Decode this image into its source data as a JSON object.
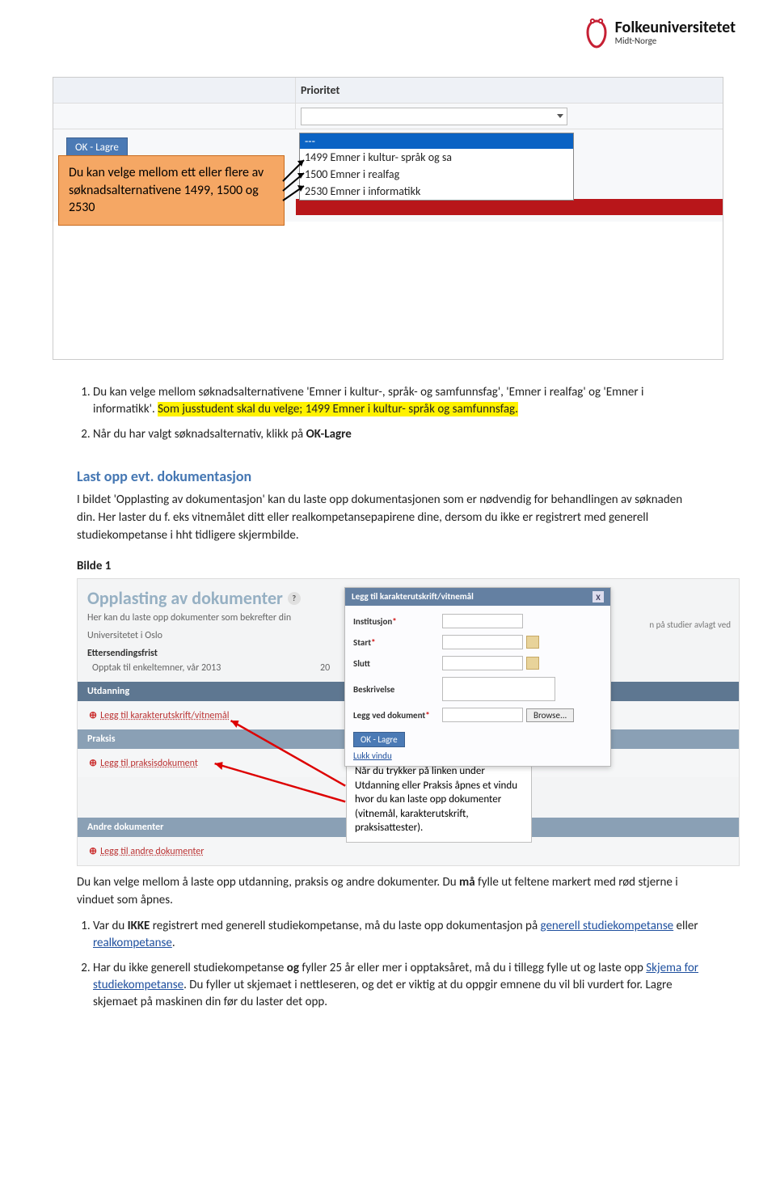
{
  "logo": {
    "name": "Folkeuniversitetet",
    "sub": "Midt-Norge"
  },
  "screenshot1": {
    "table_header": "Prioritet",
    "dropdown_placeholder": "---",
    "options": [
      "1499 Emner i kultur- språk og sa",
      "1500 Emner i realfag",
      "2530 Emner i informatikk"
    ],
    "ok_button": "OK - Lagre",
    "callout": "Du kan velge mellom ett eller flere av søknadsalternativene 1499, 1500 og 2530"
  },
  "list1": {
    "item1_pre": "Du kan velge mellom søknadsalternativene 'Emner i kultur-, språk- og samfunnsfag', 'Emner i realfag' og 'Emner i informatikk'. ",
    "item1_hl": "Som jusstudent skal du velge; 1499 Emner i kultur- språk og samfunnsfag.",
    "item2_pre": "Når du har valgt søknadsalternativ, klikk på ",
    "item2_bold": "OK-Lagre"
  },
  "section_heading": "Last opp evt. dokumentasjon",
  "para1": "I bildet 'Opplasting av dokumentasjon' kan du laste opp dokumentasjonen som er nødvendig for behandlingen av søknaden din. Her laster du f. eks vitnemålet ditt eller realkompetansepapirene dine, dersom du ikke er registrert med generell studiekompetanse i hht tidligere skjermbilde.",
  "bilde1_label": "Bilde 1",
  "screenshot2": {
    "title": "Opplasting av dokumenter",
    "help_icon": "?",
    "subtitle": "Her kan du laste opp dokumenter som bekrefter din ",
    "right_note": "n på studier avlagt ved",
    "right_note2": "Universitetet i Oslo",
    "etfrist": "Ettersendingsfrist",
    "etsub": "Opptak til enkeltemner, vår 2013",
    "etsub_date": "20",
    "sec_utdanning": "Utdanning",
    "link_utd": "Legg til karakterutskrift/vitnemål",
    "sec_praksis": "Praksis",
    "link_prk": "Legg til praksisdokument",
    "sec_andre": "Andre dokumenter",
    "link_andre": "Legg til andre dokumenter",
    "modal": {
      "title": "Legg til karakterutskrift/vitnemål",
      "close": "X",
      "institusjon": "Institusjon",
      "start": "Start",
      "slutt": "Slutt",
      "beskrivelse": "Beskrivelse",
      "legg_ved": "Legg ved dokument",
      "browse": "Browse...",
      "ok": "OK - Lagre",
      "lukk": "Lukk vindu"
    },
    "callout": "Når du trykker på linken under Utdanning eller Praksis åpnes et vindu hvor du kan laste opp dokumenter (vitnemål, karakterutskrift, praksisattester)."
  },
  "para2_a": "Du kan velge mellom å laste opp utdanning, praksis og andre dokumenter. Du ",
  "para2_b": "må",
  "para2_c": " fylle ut feltene markert med rød stjerne i vinduet som åpnes.",
  "list2": {
    "item1_a": "Var du ",
    "item1_b": "IKKE",
    "item1_c": " registrert med generell studiekompetanse, må du laste opp dokumentasjon på ",
    "item1_link1": "generell studiekompetanse",
    "item1_d": " eller ",
    "item1_link2": "realkompetanse",
    "item1_e": ".",
    "item2_a": "Har du ikke generell studiekompetanse ",
    "item2_b": "og",
    "item2_c": " fyller 25 år eller mer i opptaksåret, må du i tillegg fylle ut og laste opp ",
    "item2_link": "Skjema for studiekompetanse",
    "item2_d": ". Du fyller ut skjemaet i nettleseren, og det er viktig at du oppgir emnene du vil bli vurdert for. Lagre skjemaet på maskinen din før du laster det opp."
  }
}
